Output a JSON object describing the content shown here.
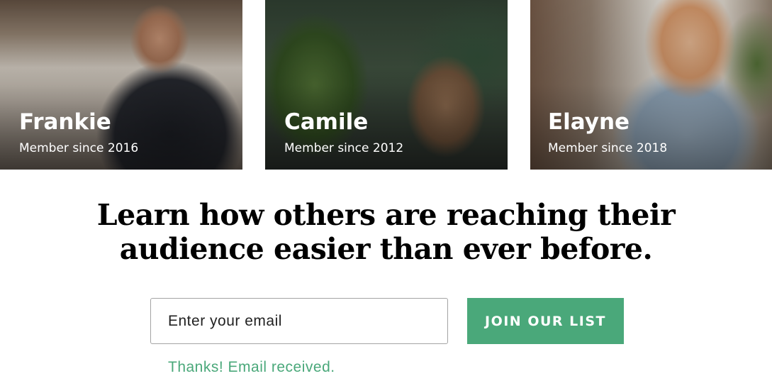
{
  "members": [
    {
      "name": "Frankie",
      "since": "Member since 2016"
    },
    {
      "name": "Camile",
      "since": "Member since 2012"
    },
    {
      "name": "Elayne",
      "since": "Member since 2018"
    }
  ],
  "headline": {
    "line1": "Learn how others are reaching their",
    "line2": "audience easier than ever before."
  },
  "signup": {
    "email_placeholder": "Enter your email",
    "email_value": "",
    "button_label": "JOIN OUR LIST",
    "confirmation": "Thanks! Email received."
  },
  "colors": {
    "accent": "#4aa87a",
    "text": "#000000",
    "card_text": "#ffffff"
  }
}
